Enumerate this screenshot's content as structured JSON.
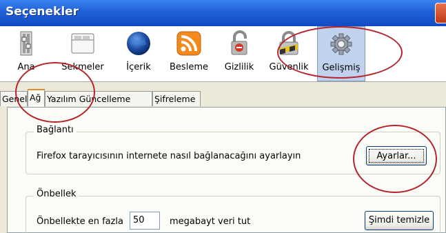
{
  "window": {
    "title": "Seçenekler"
  },
  "toolbar": {
    "items": [
      {
        "label": "Ana",
        "icon": "switch-icon"
      },
      {
        "label": "Sekmeler",
        "icon": "tabs-window-icon"
      },
      {
        "label": "İçerik",
        "icon": "globe-icon"
      },
      {
        "label": "Besleme",
        "icon": "rss-feed-icon"
      },
      {
        "label": "Gizlilik",
        "icon": "privacy-lock-icon"
      },
      {
        "label": "Güvenlik",
        "icon": "security-padlock-icon"
      },
      {
        "label": "Gelişmiş",
        "icon": "gear-icon",
        "selected": true
      }
    ]
  },
  "tabs": [
    {
      "label": "Genel"
    },
    {
      "label": "Ağ",
      "active": true
    },
    {
      "label": "Yazılım Güncelleme"
    },
    {
      "label": "Şifreleme"
    }
  ],
  "connection": {
    "group_title": "Bağlantı",
    "description": "Firefox tarayıcısının internete nasıl bağlanacağını ayarlayın",
    "button_label": "Ayarlar..."
  },
  "cache": {
    "group_title": "Önbellek",
    "label_before": "Önbellekte en fazla",
    "value": "50",
    "label_after": "megabayt veri tut",
    "button_label": "Şimdi temizle"
  },
  "colors": {
    "titlebar": "#1f5fd8",
    "annotation": "#b3252a",
    "selected_tool": "#c1d2ee"
  }
}
